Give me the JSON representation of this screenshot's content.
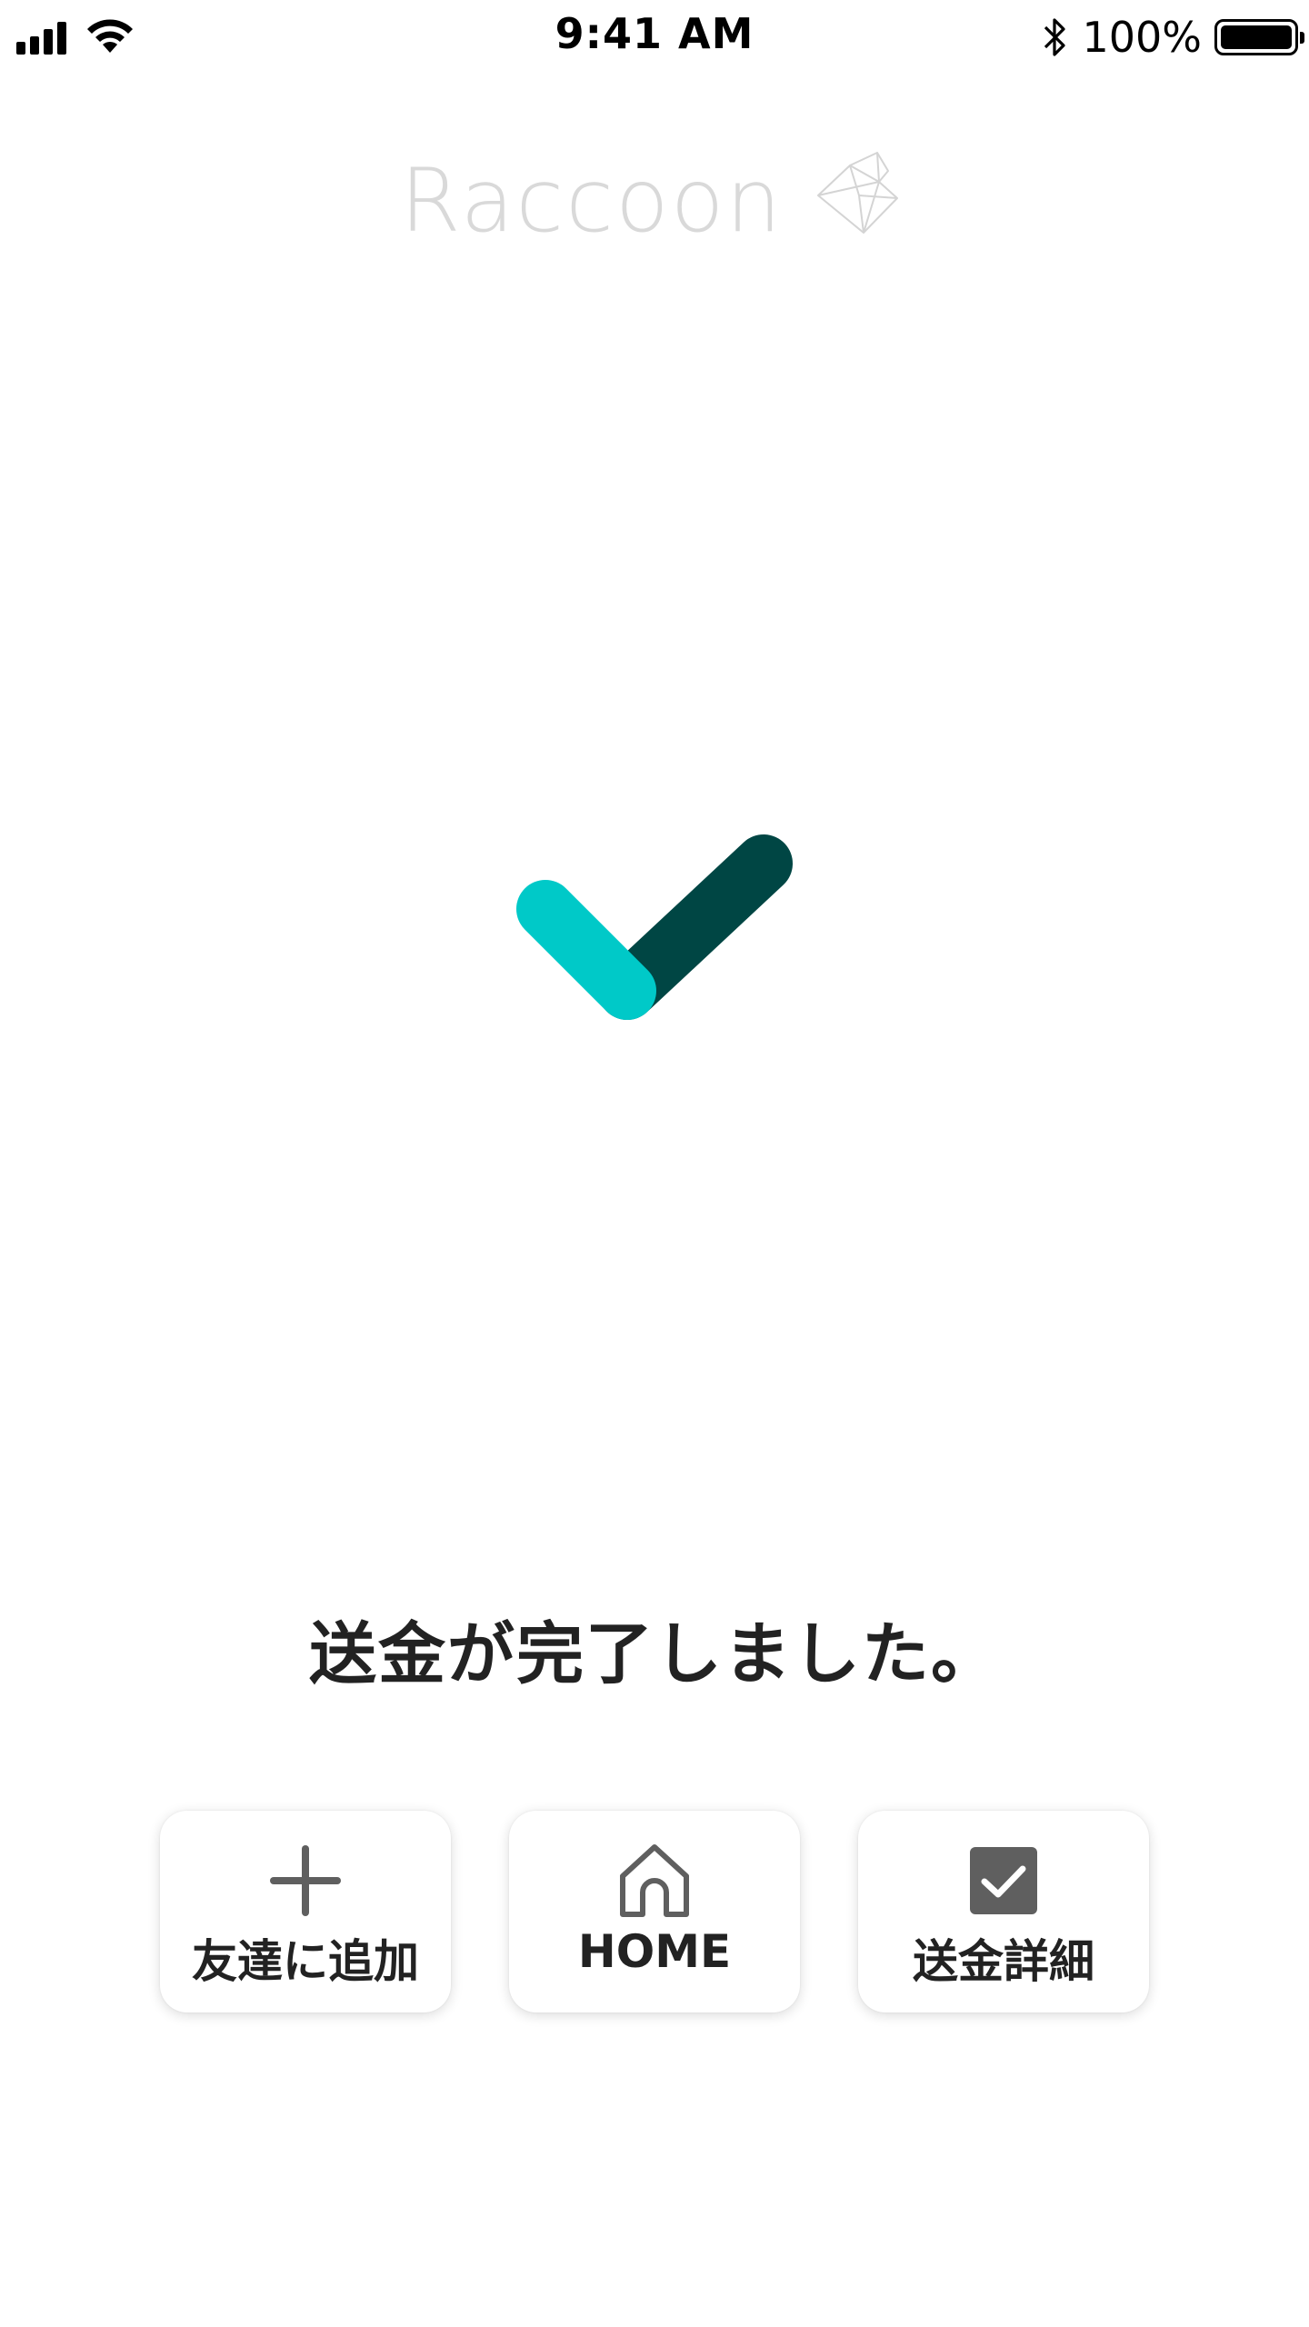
{
  "status_bar": {
    "time": "9:41 AM",
    "battery_percent": "100%",
    "icons": [
      "signal-icon",
      "wifi-icon",
      "bluetooth-icon",
      "battery-icon"
    ]
  },
  "logo": {
    "text": "Raccoon",
    "color": "#d9d9d9",
    "mark_icon": "raccoon-origami-icon"
  },
  "completion": {
    "icon": "check-mark-icon",
    "colors": {
      "short_stroke": "#00c9c8",
      "long_stroke": "#004644"
    },
    "message": "送金が完了しました。"
  },
  "actions": [
    {
      "label": "友達に追加",
      "icon": "plus-icon"
    },
    {
      "label": "HOME",
      "icon": "home-icon"
    },
    {
      "label": "送金詳細",
      "icon": "checkbox-icon"
    }
  ],
  "theme": {
    "icon_color": "#5f5f5f",
    "text_color": "#222222"
  }
}
